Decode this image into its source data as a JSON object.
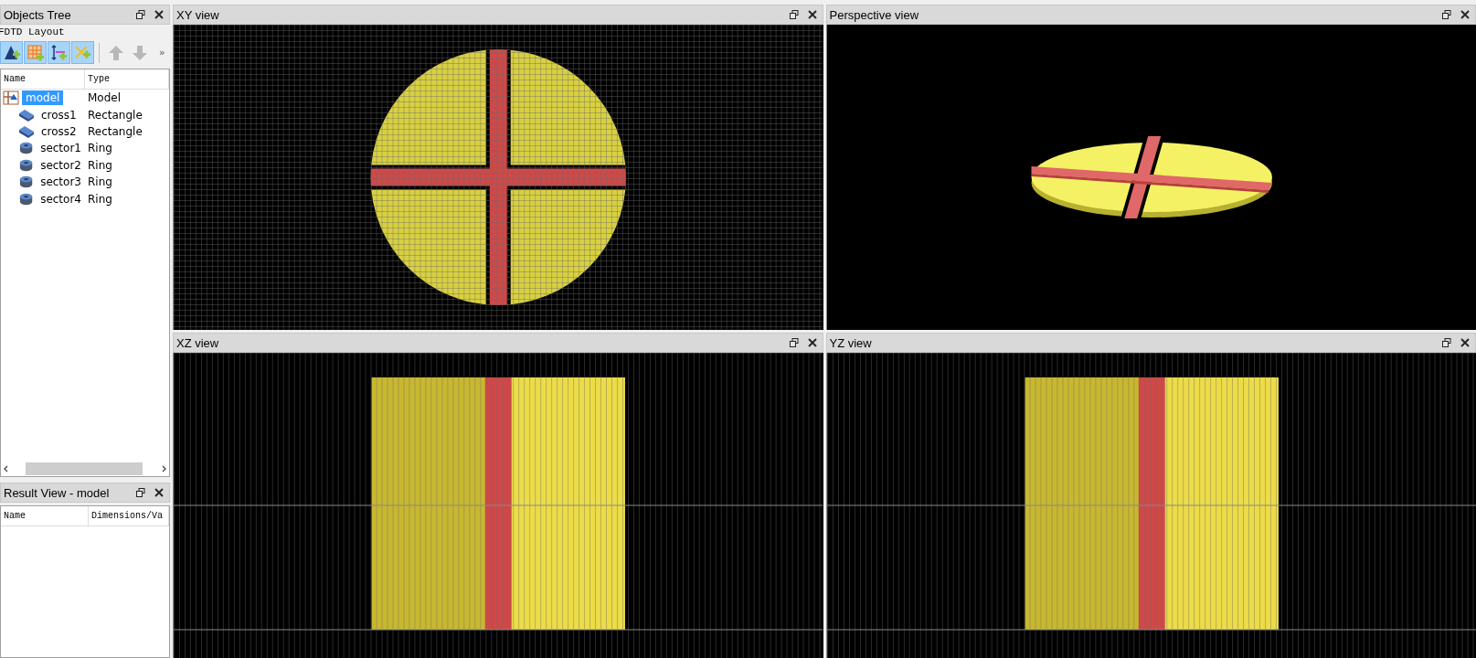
{
  "objects_tree": {
    "title": "Objects Tree",
    "subtitle": "FDTD Layout",
    "toolbar": [
      {
        "kind": "add-structure",
        "disabled": false
      },
      {
        "kind": "add-mesh",
        "disabled": false
      },
      {
        "kind": "add-monitor",
        "disabled": false
      },
      {
        "kind": "add-source",
        "disabled": false
      },
      {
        "kind": "move-up",
        "disabled": true
      },
      {
        "kind": "move-down",
        "disabled": true
      }
    ],
    "overflow": "»",
    "columns": [
      "Name",
      "Type"
    ],
    "items": [
      {
        "name": "model",
        "type": "Model",
        "kind": "model",
        "selected": true,
        "children": [
          {
            "name": "cross1",
            "type": "Rectangle",
            "kind": "rectangle",
            "selected": false
          },
          {
            "name": "cross2",
            "type": "Rectangle",
            "kind": "rectangle",
            "selected": false
          },
          {
            "name": "sector1",
            "type": "Ring",
            "kind": "ring",
            "selected": false
          },
          {
            "name": "sector2",
            "type": "Ring",
            "kind": "ring",
            "selected": false
          },
          {
            "name": "sector3",
            "type": "Ring",
            "kind": "ring",
            "selected": false
          },
          {
            "name": "sector4",
            "type": "Ring",
            "kind": "ring",
            "selected": false
          }
        ]
      }
    ]
  },
  "result_view": {
    "title": "Result View - model",
    "columns": [
      "Name",
      "Dimensions/Va"
    ]
  },
  "views": [
    {
      "title": "XY view",
      "kind": "xy"
    },
    {
      "title": "Perspective view",
      "kind": "perspective"
    },
    {
      "title": "XZ view",
      "kind": "xz"
    },
    {
      "title": "YZ view",
      "kind": "yz"
    }
  ]
}
